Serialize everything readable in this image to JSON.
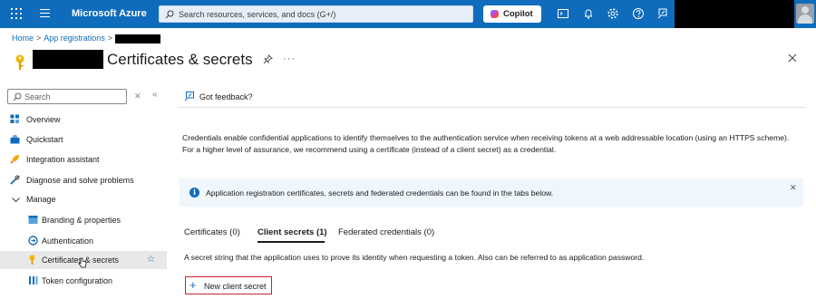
{
  "topbar": {
    "brand": "Microsoft Azure",
    "search_placeholder": "Search resources, services, and docs (G+/)",
    "copilot_label": "Copilot",
    "icons": [
      "cloud-shell-icon",
      "notifications-icon",
      "settings-icon",
      "help-icon",
      "feedback-icon"
    ]
  },
  "breadcrumb": {
    "home": "Home",
    "app_registrations": "App registrations"
  },
  "page": {
    "title": "Certificates & secrets",
    "more": "···"
  },
  "sidebar": {
    "search_placeholder": "Search",
    "items": [
      {
        "label": "Overview",
        "icon": "overview-icon"
      },
      {
        "label": "Quickstart",
        "icon": "quickstart-icon"
      },
      {
        "label": "Integration assistant",
        "icon": "rocket-icon"
      },
      {
        "label": "Diagnose and solve problems",
        "icon": "wrench-icon"
      },
      {
        "label": "Manage",
        "icon": "chevron-down-icon"
      },
      {
        "label": "Branding & properties",
        "icon": "branding-icon"
      },
      {
        "label": "Authentication",
        "icon": "authentication-icon"
      },
      {
        "label": "Certificates & secrets",
        "icon": "key-icon"
      },
      {
        "label": "Token configuration",
        "icon": "token-icon"
      }
    ]
  },
  "main": {
    "feedback_label": "Got feedback?",
    "description": "Credentials enable confidential applications to identify themselves to the authentication service when receiving tokens at a web addressable location (using an HTTPS scheme). For a higher level of assurance, we recommend using a certificate (instead of a client secret) as a credential.",
    "info_message": "Application registration certificates, secrets and federated credentials can be found in the tabs below.",
    "tabs": [
      {
        "label": "Certificates (0)"
      },
      {
        "label": "Client secrets (1)"
      },
      {
        "label": "Federated credentials (0)"
      }
    ],
    "secret_description": "A secret string that the application uses to prove its identity when requesting a token. Also can be referred to as application password.",
    "new_secret_label": "New client secret"
  },
  "colors": {
    "topbar": "#0f6cbd",
    "accent": "#0f6cbd",
    "highlight_border": "#c4262e",
    "info_bg": "#eff6fc"
  }
}
